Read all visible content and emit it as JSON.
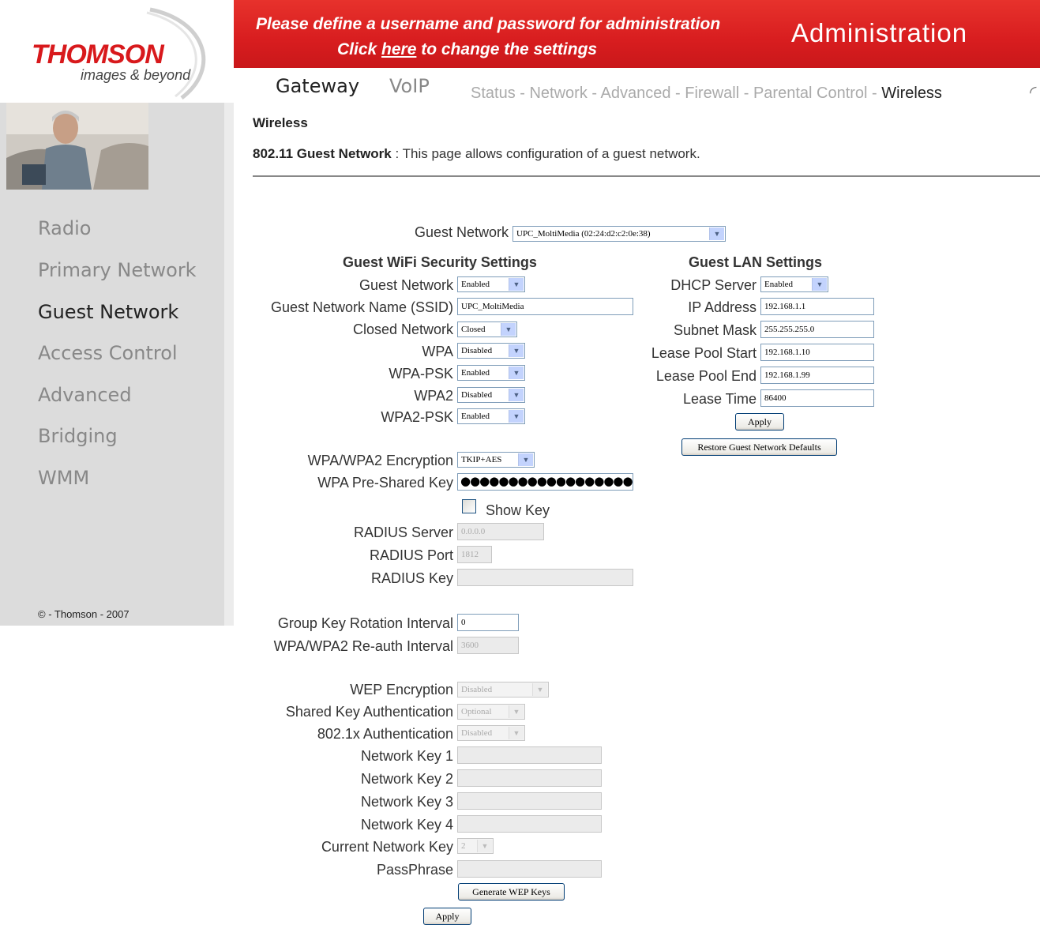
{
  "brand": {
    "name": "THOMSON",
    "tagline": "images & beyond"
  },
  "banner": {
    "line1": "Please define a username and password for administration",
    "line2_pre": "Click ",
    "line2_link": "here",
    "line2_post": " to change the settings",
    "section": "Administration"
  },
  "nav": {
    "main": [
      "Gateway",
      "VoIP"
    ],
    "sub": [
      "Status",
      "Network",
      "Advanced",
      "Firewall",
      "Parental Control",
      "Wireless"
    ],
    "separator": " - ",
    "active_sub": "Wireless"
  },
  "sidebar": {
    "items": [
      {
        "label": "Radio",
        "active": false
      },
      {
        "label": "Primary Network",
        "active": false
      },
      {
        "label": "Guest Network",
        "active": true
      },
      {
        "label": "Access Control",
        "active": false
      },
      {
        "label": "Advanced",
        "active": false
      },
      {
        "label": "Bridging",
        "active": false
      },
      {
        "label": "WMM",
        "active": false
      }
    ],
    "copyright": "© - Thomson - 2007"
  },
  "page": {
    "title": "Wireless",
    "heading": "802.11 Guest Network",
    "separator": " : ",
    "description": "This page allows configuration of a guest network."
  },
  "guest_network_select": {
    "label": "Guest Network",
    "value": "UPC_MoltiMedia (02:24:d2:c2:0e:38)"
  },
  "security": {
    "title": "Guest WiFi Security Settings",
    "guest_network": {
      "label": "Guest Network",
      "value": "Enabled"
    },
    "ssid": {
      "label": "Guest Network Name (SSID)",
      "value": "UPC_MoltiMedia"
    },
    "closed_network": {
      "label": "Closed Network",
      "value": "Closed"
    },
    "wpa": {
      "label": "WPA",
      "value": "Disabled"
    },
    "wpa_psk": {
      "label": "WPA-PSK",
      "value": "Enabled"
    },
    "wpa2": {
      "label": "WPA2",
      "value": "Disabled"
    },
    "wpa2_psk": {
      "label": "WPA2-PSK",
      "value": "Enabled"
    },
    "encryption": {
      "label": "WPA/WPA2 Encryption",
      "value": "TKIP+AES"
    },
    "psk": {
      "label": "WPA Pre-Shared Key",
      "value": "●●●●●●●●●●●●●●●●●●"
    },
    "show_key": {
      "label": "Show Key",
      "checked": false
    },
    "radius_server": {
      "label": "RADIUS Server",
      "value": "0.0.0.0"
    },
    "radius_port": {
      "label": "RADIUS Port",
      "value": "1812"
    },
    "radius_key": {
      "label": "RADIUS Key",
      "value": ""
    },
    "group_key_interval": {
      "label": "Group Key Rotation Interval",
      "value": "0"
    },
    "reauth_interval": {
      "label": "WPA/WPA2 Re-auth Interval",
      "value": "3600"
    },
    "wep_encryption": {
      "label": "WEP Encryption",
      "value": "Disabled"
    },
    "shared_key_auth": {
      "label": "Shared Key Authentication",
      "value": "Optional"
    },
    "dot1x_auth": {
      "label": "802.1x Authentication",
      "value": "Disabled"
    },
    "network_keys": [
      {
        "label": "Network Key 1",
        "value": ""
      },
      {
        "label": "Network Key 2",
        "value": ""
      },
      {
        "label": "Network Key 3",
        "value": ""
      },
      {
        "label": "Network Key 4",
        "value": ""
      }
    ],
    "current_key": {
      "label": "Current Network Key",
      "value": "2"
    },
    "passphrase": {
      "label": "PassPhrase",
      "value": ""
    },
    "generate_button": "Generate WEP Keys",
    "apply_button": "Apply"
  },
  "lan": {
    "title": "Guest LAN Settings",
    "dhcp_server": {
      "label": "DHCP Server",
      "value": "Enabled"
    },
    "ip_address": {
      "label": "IP Address",
      "value": "192.168.1.1"
    },
    "subnet_mask": {
      "label": "Subnet Mask",
      "value": "255.255.255.0"
    },
    "lease_start": {
      "label": "Lease Pool Start",
      "value": "192.168.1.10"
    },
    "lease_end": {
      "label": "Lease Pool End",
      "value": "192.168.1.99"
    },
    "lease_time": {
      "label": "Lease Time",
      "value": "86400"
    },
    "apply_button": "Apply",
    "restore_button": "Restore Guest Network Defaults"
  },
  "colors": {
    "brand_red": "#d81d1f",
    "sidebar_bg": "#dcdcdc",
    "inactive_text": "#888888"
  }
}
